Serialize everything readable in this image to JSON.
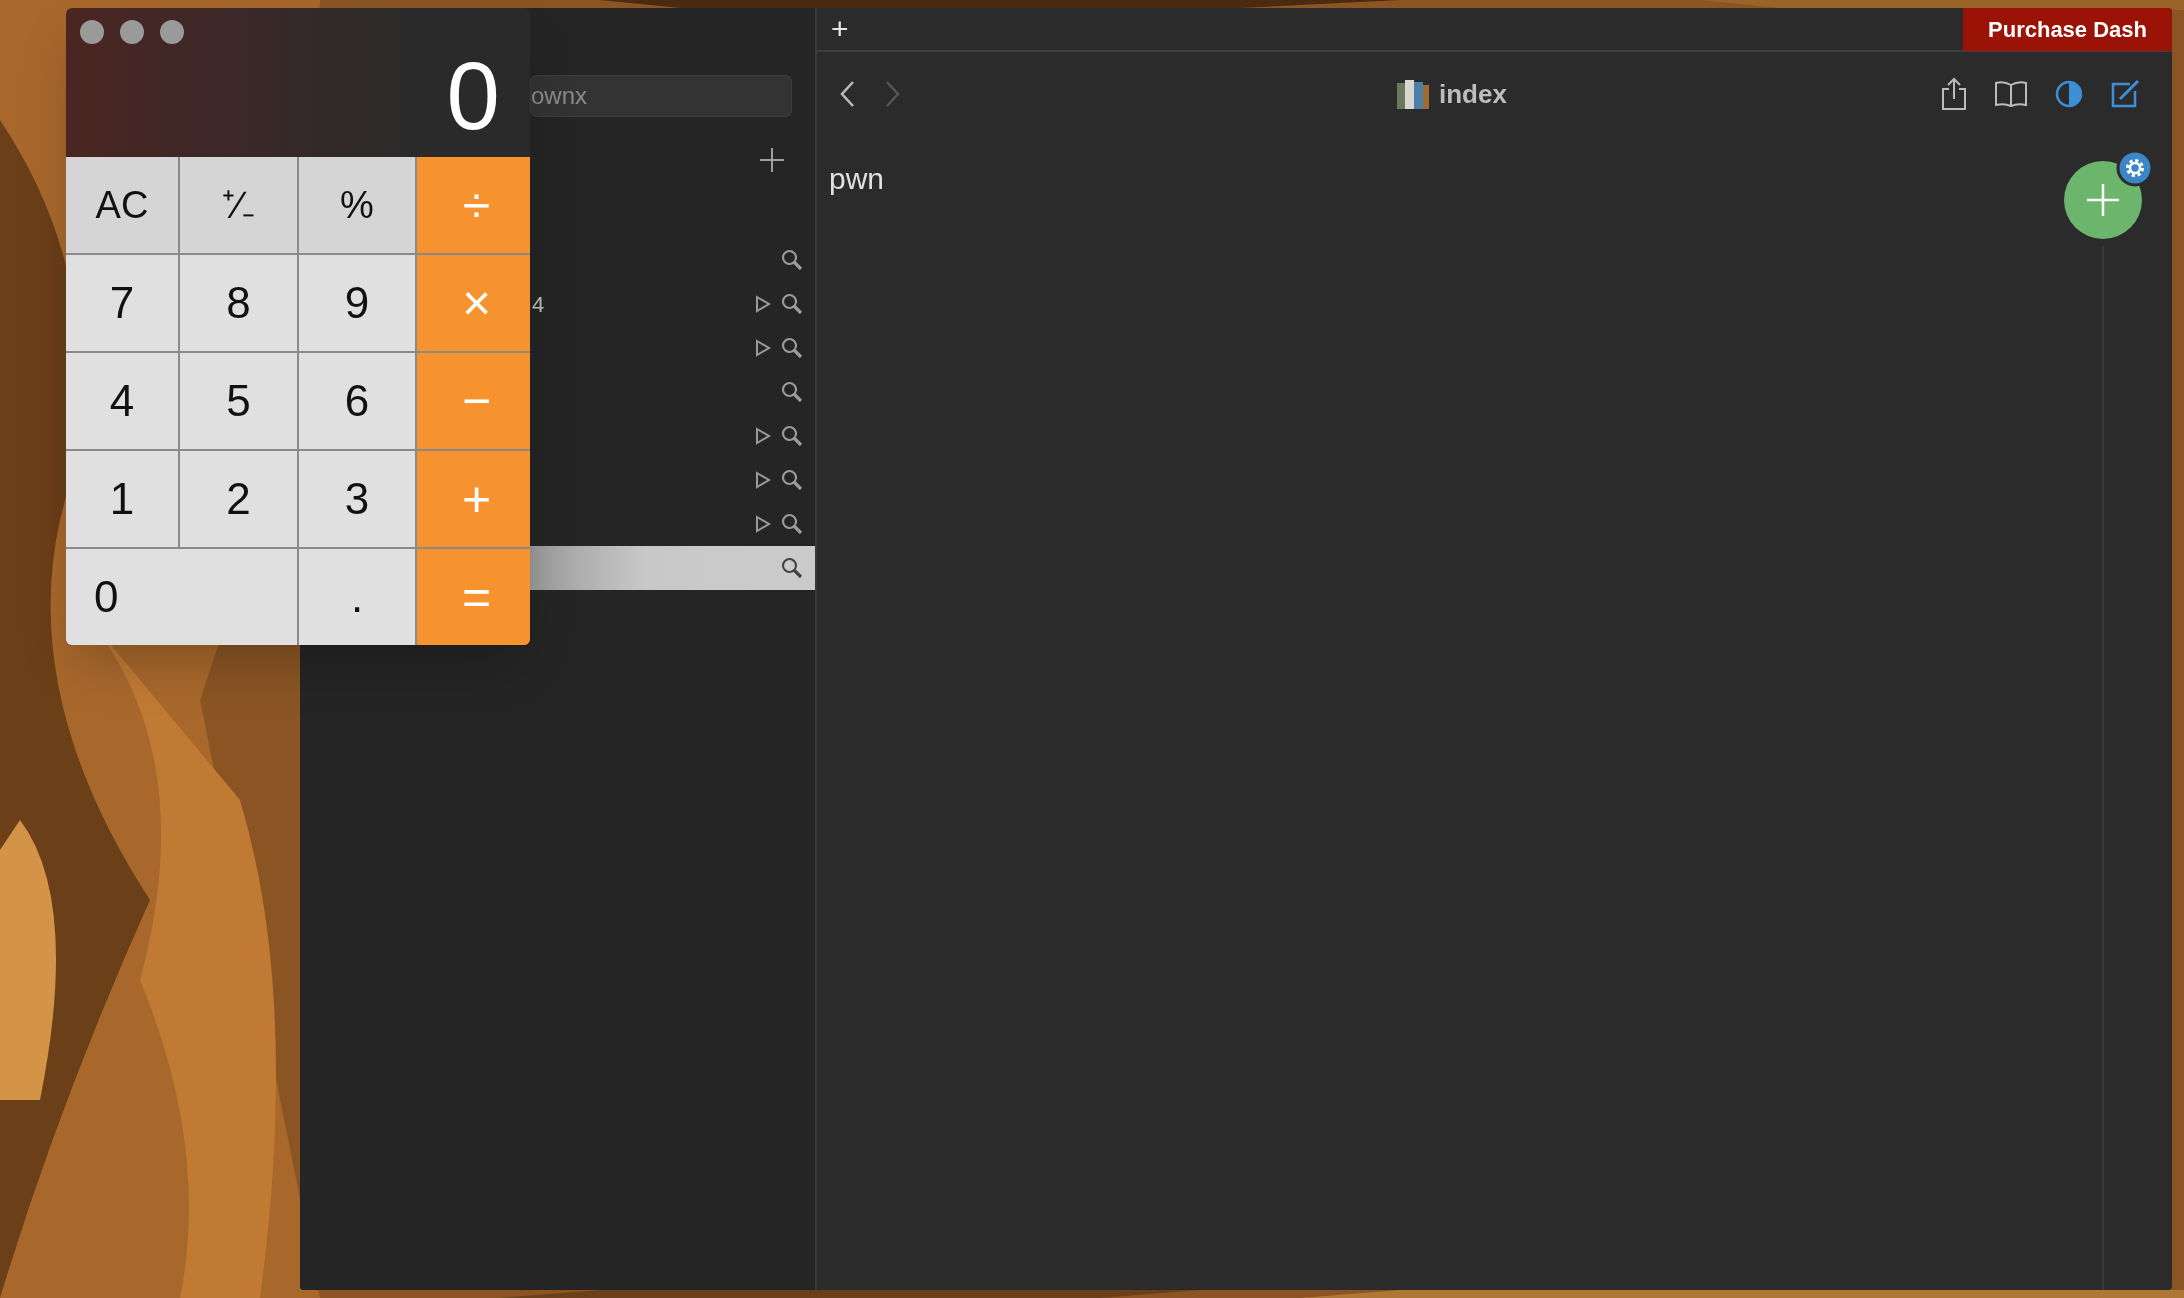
{
  "calculator": {
    "display": "0",
    "buttons": [
      {
        "label": "AC",
        "kind": "function",
        "wide": false
      },
      {
        "label": "⁺∕₋",
        "kind": "function",
        "wide": false
      },
      {
        "label": "%",
        "kind": "function",
        "wide": false
      },
      {
        "label": "÷",
        "kind": "operator",
        "wide": false
      },
      {
        "label": "7",
        "kind": "digit",
        "wide": false
      },
      {
        "label": "8",
        "kind": "digit",
        "wide": false
      },
      {
        "label": "9",
        "kind": "digit",
        "wide": false
      },
      {
        "label": "×",
        "kind": "operator",
        "wide": false
      },
      {
        "label": "4",
        "kind": "digit",
        "wide": false
      },
      {
        "label": "5",
        "kind": "digit",
        "wide": false
      },
      {
        "label": "6",
        "kind": "digit",
        "wide": false
      },
      {
        "label": "−",
        "kind": "operator",
        "wide": false
      },
      {
        "label": "1",
        "kind": "digit",
        "wide": false
      },
      {
        "label": "2",
        "kind": "digit",
        "wide": false
      },
      {
        "label": "3",
        "kind": "digit",
        "wide": false
      },
      {
        "label": "+",
        "kind": "operator",
        "wide": false
      },
      {
        "label": "0",
        "kind": "digit",
        "wide": true
      },
      {
        "label": ".",
        "kind": "digit",
        "wide": false
      },
      {
        "label": "=",
        "kind": "operator",
        "wide": false
      }
    ]
  },
  "sidebar": {
    "search": {
      "value": "ownx"
    },
    "rows": [
      {
        "label": "",
        "expandable": false,
        "selected": false
      },
      {
        "label": "4",
        "expandable": true,
        "selected": false
      },
      {
        "label": "",
        "expandable": true,
        "selected": false
      },
      {
        "label": "",
        "expandable": false,
        "selected": false
      },
      {
        "label": "",
        "expandable": true,
        "selected": false
      },
      {
        "label": "",
        "expandable": true,
        "selected": false
      },
      {
        "label": "",
        "expandable": true,
        "selected": false
      },
      {
        "label": "",
        "expandable": false,
        "selected": true
      }
    ]
  },
  "tab_bar": {
    "new_tab": "+",
    "purchase_button": "Purchase Dash"
  },
  "toolbar": {
    "title": "index",
    "back_enabled": true,
    "forward_enabled": false
  },
  "content": {
    "text": "pwn"
  }
}
